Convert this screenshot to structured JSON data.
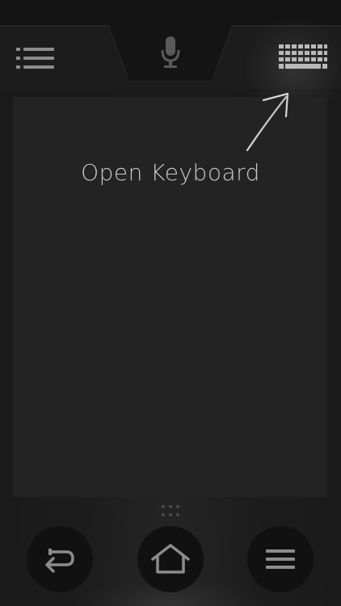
{
  "toolbar": {
    "list_icon": "list-icon",
    "mic_icon": "microphone-icon",
    "keyboard_icon": "keyboard-icon"
  },
  "touchpad": {
    "hint_label": "Open Keyboard"
  },
  "nav": {
    "back_icon": "back-icon",
    "home_icon": "home-icon",
    "menu_icon": "menu-icon"
  },
  "colors": {
    "background": "#1a1a1a",
    "touchpad": "#232323",
    "toolbar": "#262626",
    "icon": "#8c8c8c",
    "nav_button": "#111111",
    "hint_text": "#c8c8c8"
  }
}
